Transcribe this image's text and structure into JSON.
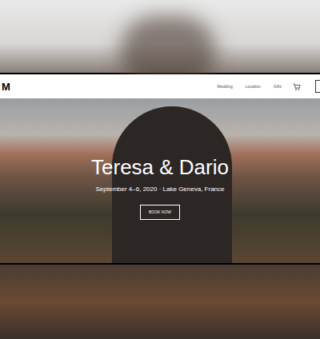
{
  "site": {
    "logo": "M",
    "nav": [
      {
        "label": "Wedding"
      },
      {
        "label": "Location"
      },
      {
        "label": "Gifts"
      }
    ]
  },
  "hero": {
    "title": "Teresa & Dario",
    "subtitle": "September 4–6, 2020 · Lake Geneva, France",
    "button": "BOOK NOW"
  }
}
